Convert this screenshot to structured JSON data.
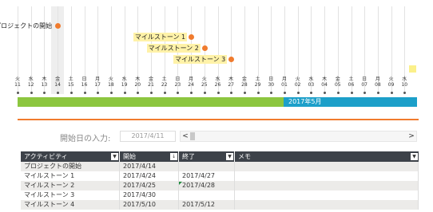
{
  "timeline": {
    "days": [
      {
        "weekday": "火",
        "date": "11"
      },
      {
        "weekday": "水",
        "date": "12"
      },
      {
        "weekday": "木",
        "date": "13"
      },
      {
        "weekday": "金",
        "date": "14"
      },
      {
        "weekday": "土",
        "date": "15"
      },
      {
        "weekday": "日",
        "date": "16"
      },
      {
        "weekday": "月",
        "date": "17"
      },
      {
        "weekday": "火",
        "date": "18"
      },
      {
        "weekday": "水",
        "date": "19"
      },
      {
        "weekday": "木",
        "date": "20"
      },
      {
        "weekday": "金",
        "date": "21"
      },
      {
        "weekday": "土",
        "date": "22"
      },
      {
        "weekday": "日",
        "date": "23"
      },
      {
        "weekday": "月",
        "date": "24"
      },
      {
        "weekday": "火",
        "date": "25"
      },
      {
        "weekday": "水",
        "date": "26"
      },
      {
        "weekday": "木",
        "date": "27"
      },
      {
        "weekday": "金",
        "date": "28"
      },
      {
        "weekday": "土",
        "date": "29"
      },
      {
        "weekday": "日",
        "date": "30"
      },
      {
        "weekday": "月",
        "date": "01"
      },
      {
        "weekday": "火",
        "date": "02"
      },
      {
        "weekday": "水",
        "date": "03"
      },
      {
        "weekday": "木",
        "date": "04"
      },
      {
        "weekday": "金",
        "date": "05"
      },
      {
        "weekday": "土",
        "date": "06"
      },
      {
        "weekday": "日",
        "date": "07"
      },
      {
        "weekday": "月",
        "date": "08"
      },
      {
        "weekday": "火",
        "date": "09"
      },
      {
        "weekday": "水",
        "date": "10"
      }
    ],
    "milestones": [
      {
        "label": "プロジェクトの開始",
        "day_index": 3
      },
      {
        "label": "マイルストーン 1",
        "day_index": 13
      },
      {
        "label": "マイルストーン 2",
        "day_index": 14
      },
      {
        "label": "マイルストーン 3",
        "day_index": 16
      }
    ],
    "month_label": "2017年5月",
    "colors": {
      "april_bar": "#8cc63f",
      "may_bar": "#1c9fc9",
      "milestone_dot": "#f07b2e",
      "milestone_label_bg": "#fff2a8",
      "separator": "#f07b2e"
    }
  },
  "controls": {
    "start_label": "開始日の入力:",
    "start_value": "2017/4/11",
    "scroll_left": "<",
    "scroll_right": ">"
  },
  "table": {
    "headers": [
      "アクティビティ",
      "開始",
      "終了",
      "メモ"
    ],
    "rows": [
      [
        "プロジェクトの開始",
        "2017/4/14",
        "",
        ""
      ],
      [
        "マイルストーン 1",
        "2017/4/24",
        "2017/4/27",
        ""
      ],
      [
        "マイルストーン 2",
        "2017/4/25",
        "2017/4/28",
        ""
      ],
      [
        "マイルストーン 3",
        "2017/4/30",
        "",
        ""
      ],
      [
        "マイルストーン 4",
        "2017/5/10",
        "2017/5/12",
        ""
      ]
    ]
  }
}
